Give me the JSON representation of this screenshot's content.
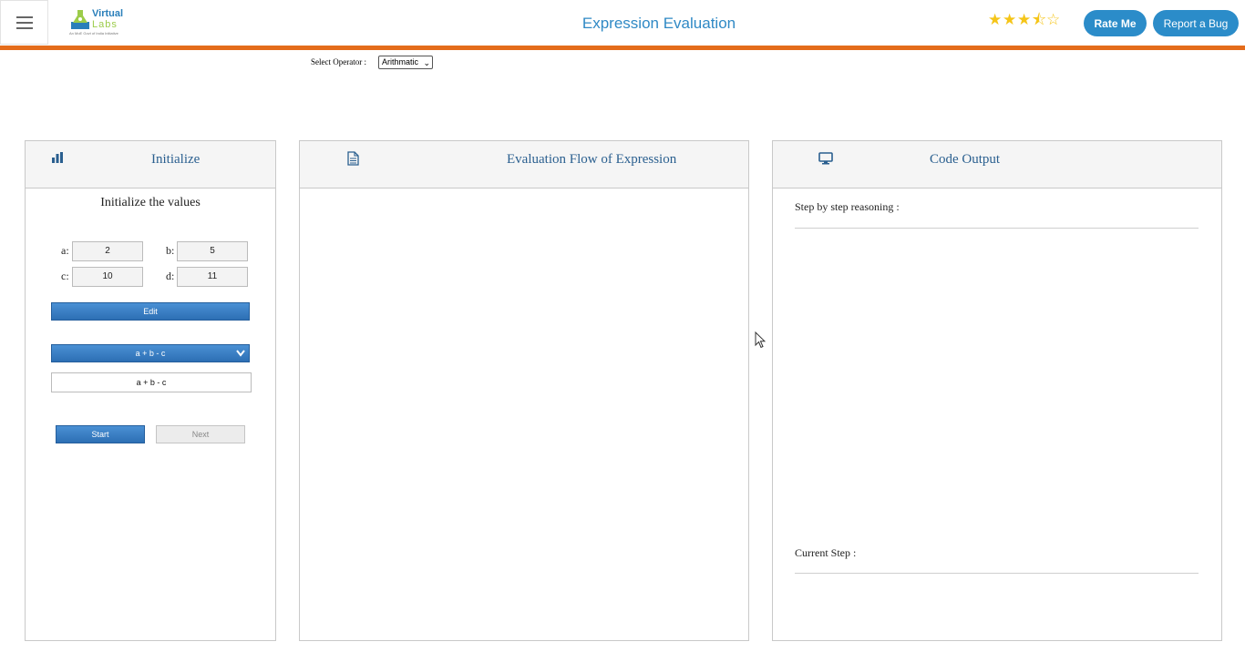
{
  "header": {
    "logo": {
      "line1": "Virtual",
      "line2": "Labs",
      "tagline": "An MoE Govt of India Initiative"
    },
    "title": "Expression Evaluation",
    "rating": {
      "value": 3.5,
      "max": 5
    },
    "rate_label": "Rate Me",
    "bug_label": "Report a Bug"
  },
  "operator": {
    "label": "Select Operator :",
    "selected": "Arithmatic"
  },
  "initialize": {
    "title": "Initialize",
    "subtitle": "Initialize the values",
    "vars": {
      "a": {
        "label": "a:",
        "value": "2"
      },
      "b": {
        "label": "b:",
        "value": "5"
      },
      "c": {
        "label": "c:",
        "value": "10"
      },
      "d": {
        "label": "d:",
        "value": "11"
      }
    },
    "edit_label": "Edit",
    "expression_selected": "a + b - c",
    "expression_display": "a + b - c",
    "start_label": "Start",
    "next_label": "Next"
  },
  "flow": {
    "title": "Evaluation Flow of Expression"
  },
  "output": {
    "title": "Code Output",
    "reasoning_label": "Step by step reasoning :",
    "current_step_label": "Current Step :"
  },
  "colors": {
    "accent": "#2b8cc9",
    "orange": "#e46c1b",
    "panel_title": "#2a5f8f"
  }
}
